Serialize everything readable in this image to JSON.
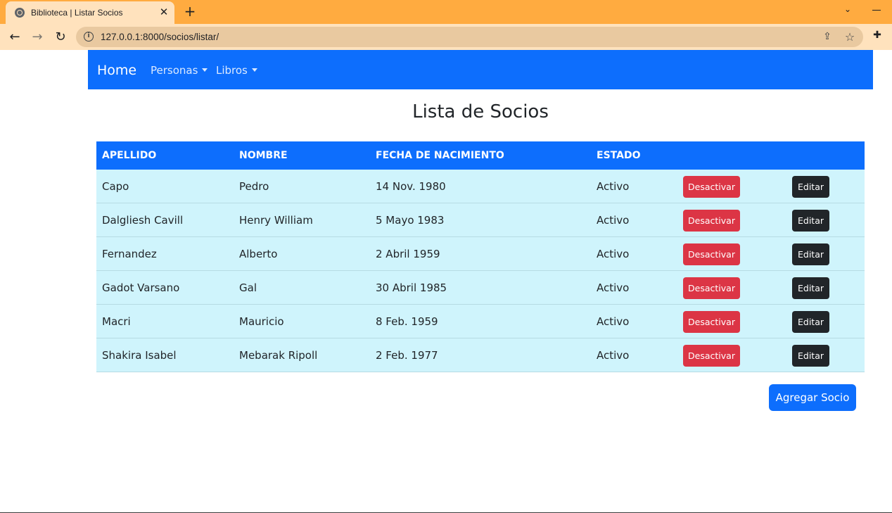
{
  "browser": {
    "tab_title": "Biblioteca | Listar Socios",
    "url": "127.0.0.1:8000/socios/listar/"
  },
  "navbar": {
    "brand": "Home",
    "items": [
      {
        "label": "Personas"
      },
      {
        "label": "Libros"
      }
    ],
    "color": "#0d6efd"
  },
  "page": {
    "title": "Lista de Socios"
  },
  "table": {
    "headers": [
      "APELLIDO",
      "NOMBRE",
      "FECHA DE NACIMIENTO",
      "ESTADO"
    ],
    "rows": [
      {
        "apellido": "Capo",
        "nombre": "Pedro",
        "fecha": "14 Nov. 1980",
        "estado": "Activo"
      },
      {
        "apellido": "Dalgliesh Cavill",
        "nombre": "Henry William",
        "fecha": "5 Mayo 1983",
        "estado": "Activo"
      },
      {
        "apellido": "Fernandez",
        "nombre": "Alberto",
        "fecha": "2 Abril 1959",
        "estado": "Activo"
      },
      {
        "apellido": "Gadot Varsano",
        "nombre": "Gal",
        "fecha": "30 Abril 1985",
        "estado": "Activo"
      },
      {
        "apellido": "Macri",
        "nombre": "Mauricio",
        "fecha": "8 Feb. 1959",
        "estado": "Activo"
      },
      {
        "apellido": "Shakira Isabel",
        "nombre": "Mebarak Ripoll",
        "fecha": "2 Feb. 1977",
        "estado": "Activo"
      }
    ],
    "deactivate_label": "Desactivar",
    "edit_label": "Editar",
    "row_color": "#cff4fc"
  },
  "actions": {
    "add_label": "Agregar Socio"
  }
}
